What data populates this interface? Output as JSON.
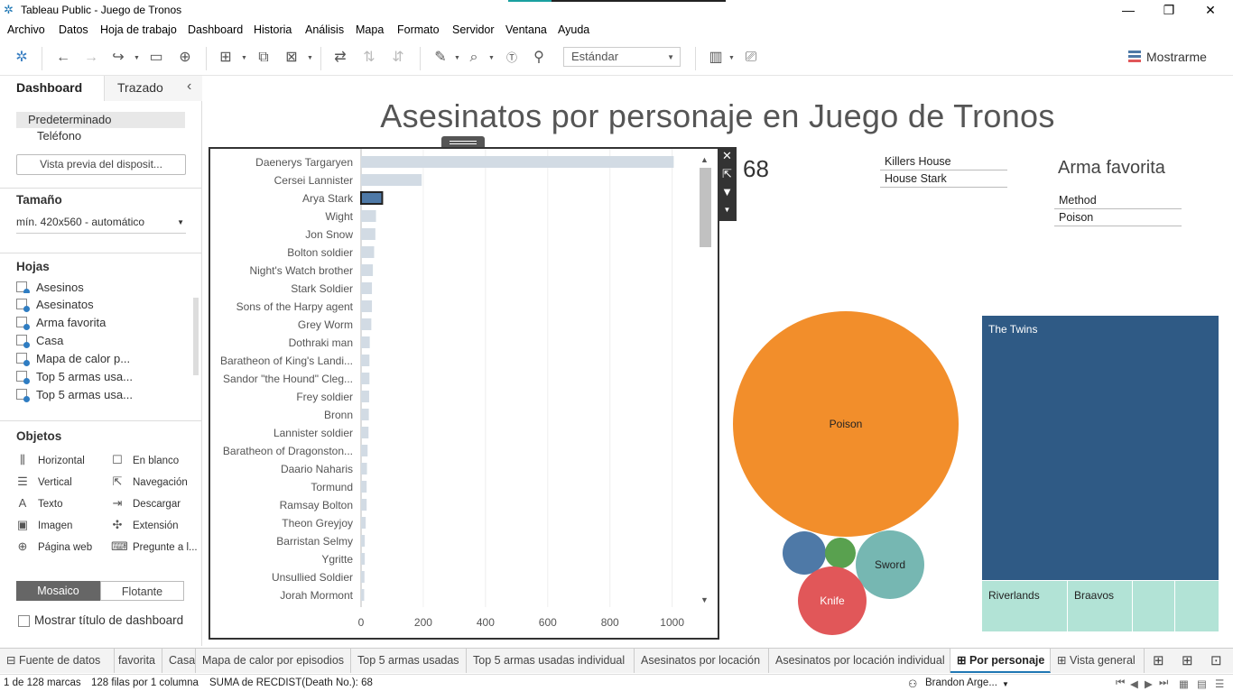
{
  "window": {
    "title": "Tableau Public - Juego de Tronos",
    "controls": {
      "minimize": "—",
      "restore": "❐",
      "close": "✕"
    }
  },
  "menu": [
    "Archivo",
    "Datos",
    "Hoja de trabajo",
    "Dashboard",
    "Historia",
    "Análisis",
    "Mapa",
    "Formato",
    "Servidor",
    "Ventana",
    "Ayuda"
  ],
  "toolbar": {
    "fit_dropdown": "Estándar",
    "show_me": "Mostrarme"
  },
  "left_panel": {
    "tabs": [
      "Dashboard",
      "Trazado"
    ],
    "collapse_icon": "‹",
    "devices": [
      "Predeterminado",
      "Teléfono"
    ],
    "preview_button": "Vista previa del disposit...",
    "size_heading": "Tamaño",
    "size_value": "mín. 420x560 - automático",
    "sheets_heading": "Hojas",
    "sheets": [
      "Asesinos",
      "Asesinatos",
      "Arma favorita",
      "Casa",
      "Mapa de calor p...",
      "Top 5 armas usa...",
      "Top 5 armas usa..."
    ],
    "objects_heading": "Objetos",
    "objects": [
      {
        "label": "Horizontal",
        "icon": "horizontal-icon",
        "glyph": "⫼"
      },
      {
        "label": "En blanco",
        "icon": "blank-icon",
        "glyph": "☐"
      },
      {
        "label": "Vertical",
        "icon": "vertical-icon",
        "glyph": "☰"
      },
      {
        "label": "Navegación",
        "icon": "navigation-icon",
        "glyph": "⇱"
      },
      {
        "label": "Texto",
        "icon": "text-icon",
        "glyph": "A"
      },
      {
        "label": "Descargar",
        "icon": "download-icon",
        "glyph": "⇥"
      },
      {
        "label": "Imagen",
        "icon": "image-icon",
        "glyph": "▣"
      },
      {
        "label": "Extensión",
        "icon": "extension-icon",
        "glyph": "✣"
      },
      {
        "label": "Página web",
        "icon": "webpage-icon",
        "glyph": "⊕"
      },
      {
        "label": "Pregunte a l...",
        "icon": "ask-data-icon",
        "glyph": "⌨"
      }
    ],
    "mode_buttons": [
      "Mosaico",
      "Flotante"
    ],
    "show_title_label": "Mostrar título de dashboard"
  },
  "dashboard": {
    "title": "Asesinatos por personaje en Juego de Tronos",
    "kpi_value": "68",
    "filter_legend": [
      "Killers House",
      "House Stark"
    ],
    "weapon_heading": "Arma favorita",
    "weapon_legend": [
      "Method",
      "Poison"
    ],
    "bubbles": [
      {
        "label": "Poison",
        "color": "#f28e2b"
      },
      {
        "label": "",
        "color": "#4e79a7"
      },
      {
        "label": "",
        "color": "#59a14f"
      },
      {
        "label": "Sword",
        "color": "#76b7b2"
      },
      {
        "label": "Knife",
        "color": "#e15759"
      }
    ],
    "treemap": {
      "main_label": "The Twins",
      "main_color": "#2f5a85",
      "sub_labels": [
        "Riverlands",
        "Braavos"
      ],
      "sub_color": "#b2e3d6"
    }
  },
  "chart_data": {
    "type": "bar",
    "orientation": "horizontal",
    "categories": [
      "Daenerys Targaryen",
      "Cersei Lannister",
      "Arya Stark",
      "Wight",
      "Jon Snow",
      "Bolton soldier",
      "Night's Watch brother",
      "Stark Soldier",
      "Sons of the Harpy agent",
      "Grey Worm",
      "Dothraki man",
      "Baratheon of King's Landi...",
      "Sandor \"the Hound\" Cleg...",
      "Frey soldier",
      "Bronn",
      "Lannister soldier",
      "Baratheon of Dragonston...",
      "Daario Naharis",
      "Tormund",
      "Ramsay Bolton",
      "Theon Greyjoy",
      "Barristan Selmy",
      "Ygritte",
      "Unsullied Soldier",
      "Jorah Mormont"
    ],
    "values": [
      1005,
      195,
      68,
      48,
      46,
      42,
      38,
      35,
      35,
      33,
      28,
      27,
      27,
      26,
      25,
      24,
      21,
      19,
      18,
      18,
      15,
      12,
      12,
      11,
      10
    ],
    "highlighted": "Arya Stark",
    "x_ticks": [
      0,
      200,
      400,
      600,
      800,
      1000
    ],
    "xlim": [
      0,
      1030
    ],
    "bar_color": "#d2dbe4",
    "highlight_color": "#4e79a7"
  },
  "bottom_tabs": [
    "Fuente de datos",
    "favorita",
    "Casa",
    "Mapa de calor por episodios",
    "Top 5 armas usadas",
    "Top 5 armas usadas individual",
    "Asesinatos por locación",
    "Asesinatos por locación individual",
    "Por personaje",
    "Vista general"
  ],
  "status": {
    "marks": "1 de 128 marcas",
    "rows": "128 filas por 1 columna",
    "sum": "SUMA de RECDIST(Death No.): 68",
    "user": "Brandon Arge..."
  }
}
